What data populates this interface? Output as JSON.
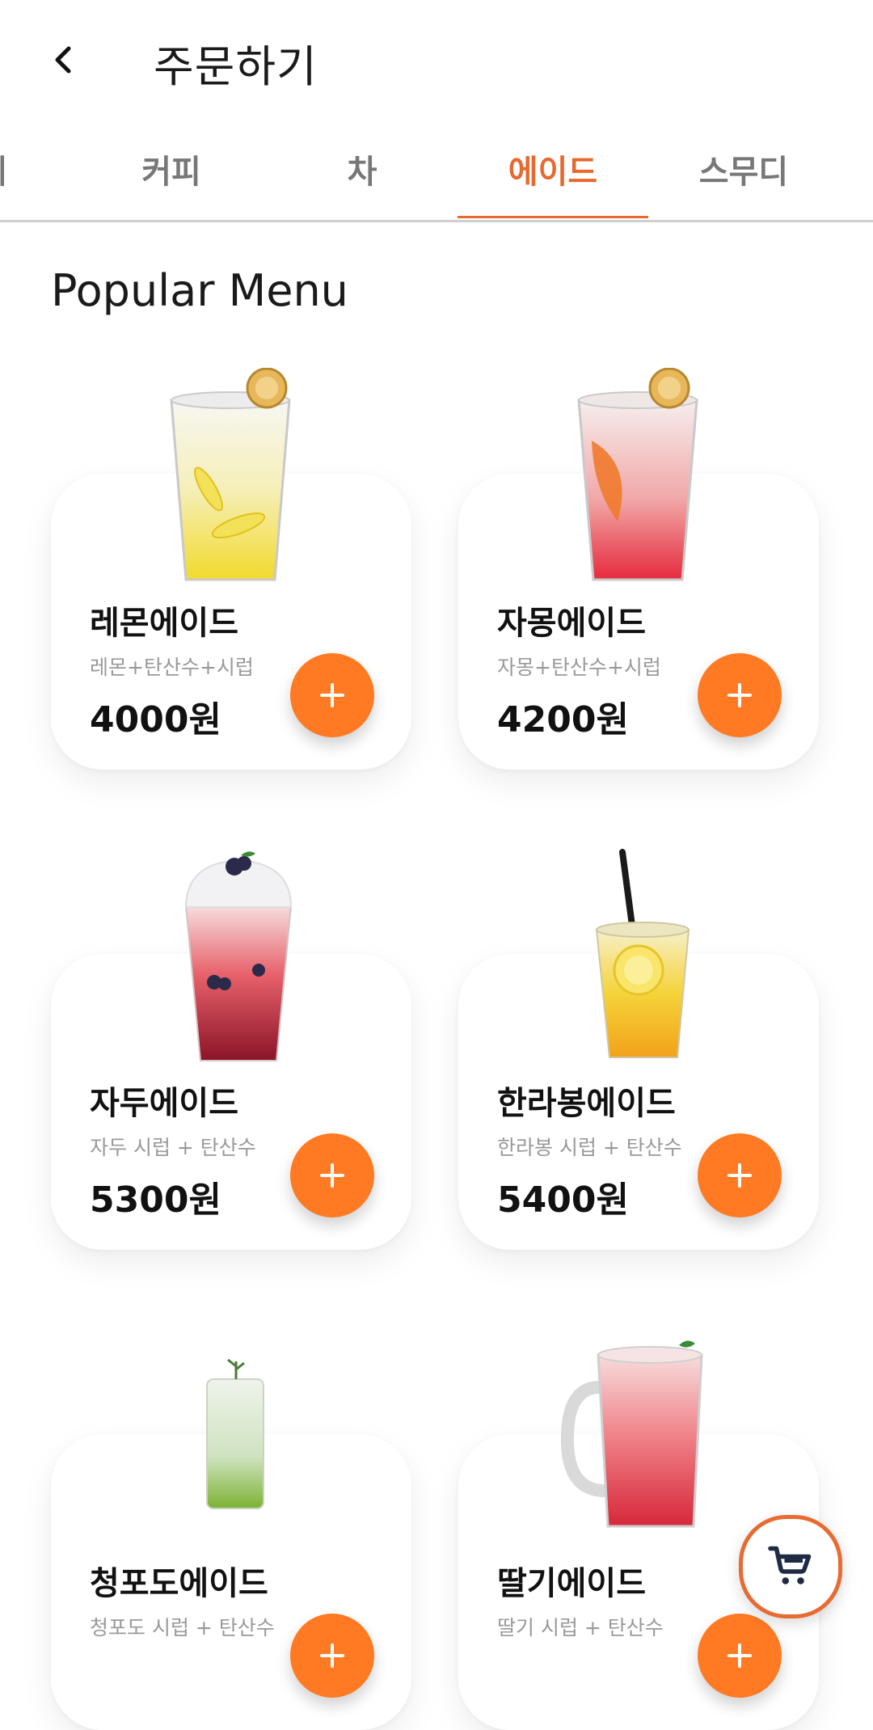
{
  "header": {
    "title": "주문하기"
  },
  "tabs": [
    {
      "label": "메"
    },
    {
      "label": "커피"
    },
    {
      "label": "차"
    },
    {
      "label": "에이드",
      "active": true
    },
    {
      "label": "스무디"
    }
  ],
  "section": {
    "title": "Popular Menu"
  },
  "menu": [
    {
      "name": "레몬에이드",
      "desc": "레몬+탄산수+시럽",
      "price": "4000원"
    },
    {
      "name": "자몽에이드",
      "desc": "자몽+탄산수+시럽",
      "price": "4200원"
    },
    {
      "name": "자두에이드",
      "desc": "자두 시럽 + 탄산수",
      "price": "5300원"
    },
    {
      "name": "한라봉에이드",
      "desc": "한라봉 시럽 + 탄산수",
      "price": "5400원"
    },
    {
      "name": "청포도에이드",
      "desc": "청포도 시럽 + 탄산수",
      "price": ""
    },
    {
      "name": "딸기에이드",
      "desc": "딸기 시럽 + 탄산수",
      "price": ""
    }
  ],
  "icons": {
    "back": "chevron-left-icon",
    "add": "plus-icon",
    "cart": "cart-icon"
  },
  "colors": {
    "accent": "#ff7a23",
    "active_tab": "#e8692e",
    "cart_icon": "#1f2a44"
  }
}
